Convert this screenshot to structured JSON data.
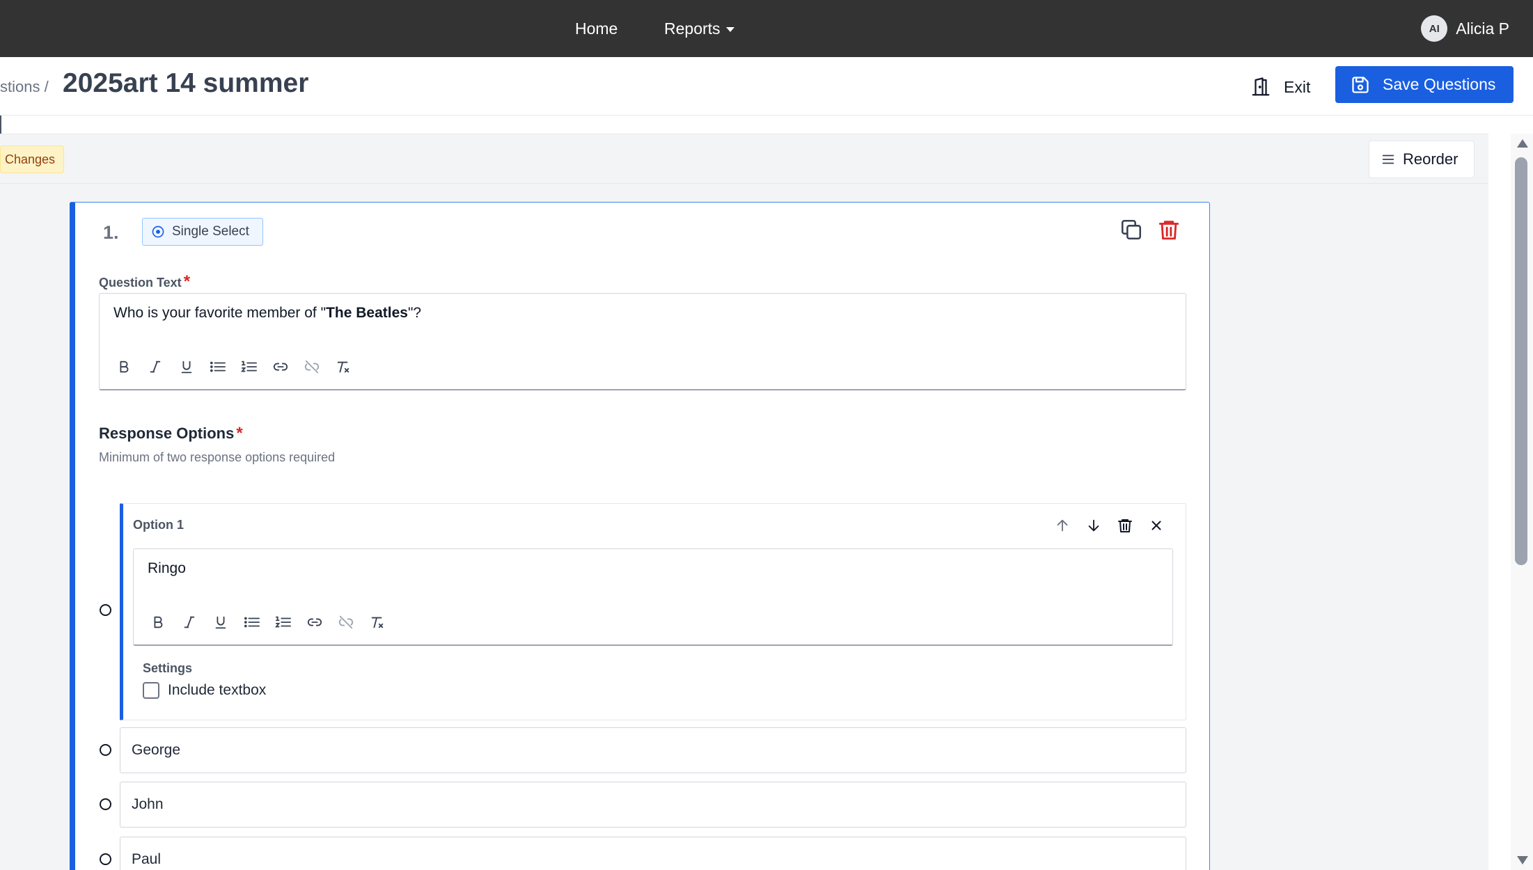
{
  "nav": {
    "home": "Home",
    "reports": "Reports",
    "user_initials": "AI",
    "user_name": "Alicia P"
  },
  "header": {
    "breadcrumb": "stions /",
    "title": "2025art 14 summer",
    "exit_label": "Exit",
    "save_label": "Save Questions"
  },
  "toolbar": {
    "changes_badge": "Changes",
    "reorder_label": "Reorder"
  },
  "question": {
    "number": "1.",
    "type": "Single Select",
    "text_label": "Question Text",
    "text_prefix": "Who is your favorite member of \"",
    "text_bold": "The Beatles",
    "text_suffix": "\"?",
    "response_title": "Response Options",
    "response_help": "Minimum of two response options required",
    "required_mark": "*"
  },
  "option_editor": {
    "title": "Option 1",
    "value": "Ringo",
    "settings_label": "Settings",
    "include_textbox_label": "Include textbox"
  },
  "options": [
    {
      "label": "George"
    },
    {
      "label": "John"
    },
    {
      "label": "Paul"
    }
  ],
  "colors": {
    "nav_bg": "#333333",
    "primary": "#1a5fe0",
    "danger": "#dc2626",
    "badge_bg": "#fef3c7"
  }
}
